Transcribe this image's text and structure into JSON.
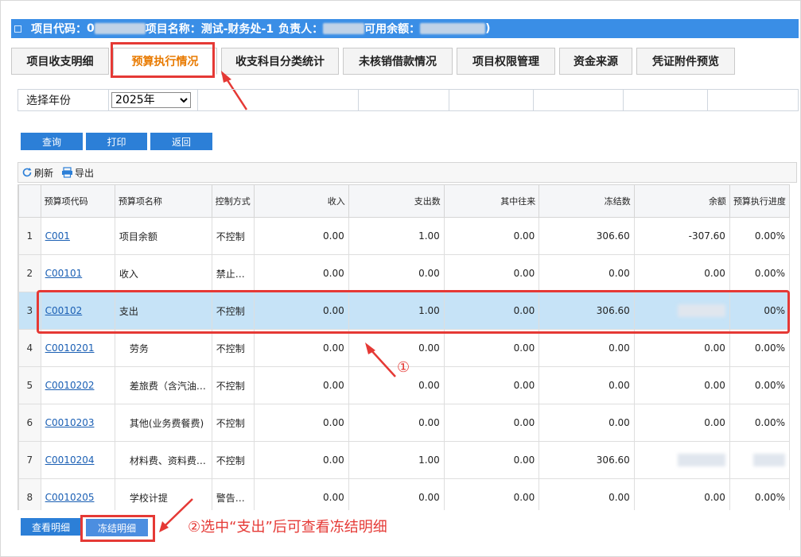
{
  "header": {
    "project_code_label": "项目代码：",
    "project_code_value": "0",
    "project_name_label": "项目名称：",
    "project_name_value": "测试-财务处-1",
    "owner_label": "负责人：",
    "balance_label": "可用余额：",
    "close_paren": ")"
  },
  "tabs": [
    {
      "label": "项目收支明细"
    },
    {
      "label": "预算执行情况"
    },
    {
      "label": "收支科目分类统计"
    },
    {
      "label": "未核销借款情况"
    },
    {
      "label": "项目权限管理"
    },
    {
      "label": "资金来源"
    },
    {
      "label": "凭证附件预览"
    }
  ],
  "filter": {
    "year_label": "选择年份",
    "year_value": "2025年"
  },
  "buttons": {
    "query": "查询",
    "print": "打印",
    "back": "返回",
    "view_detail": "查看明细",
    "frozen_detail": "冻结明细"
  },
  "toolbar": {
    "refresh": "刷新",
    "export": "导出"
  },
  "table": {
    "headers": [
      "预算项代码",
      "预算项名称",
      "控制方式",
      "收入",
      "支出数",
      "其中往来",
      "冻结数",
      "余额",
      "预算执行进度"
    ],
    "rows": [
      {
        "idx": "1",
        "code": "C001",
        "name": "项目余额",
        "control": "不控制",
        "income": "0.00",
        "expense": "1.00",
        "transit": "0.00",
        "frozen": "306.60",
        "balance": "-307.60",
        "progress": "0.00%"
      },
      {
        "idx": "2",
        "code": "C00101",
        "name": "收入",
        "control": "禁止…",
        "income": "0.00",
        "expense": "0.00",
        "transit": "0.00",
        "frozen": "0.00",
        "balance": "0.00",
        "progress": "0.00%"
      },
      {
        "idx": "3",
        "code": "C00102",
        "name": "支出",
        "control": "不控制",
        "income": "0.00",
        "expense": "1.00",
        "transit": "0.00",
        "frozen": "306.60",
        "balance": "",
        "progress": "00%"
      },
      {
        "idx": "4",
        "code": "C0010201",
        "name": "劳务",
        "control": "不控制",
        "income": "0.00",
        "expense": "0.00",
        "transit": "0.00",
        "frozen": "0.00",
        "balance": "0.00",
        "progress": "0.00%"
      },
      {
        "idx": "5",
        "code": "C0010202",
        "name": "差旅费（含汽油…",
        "control": "不控制",
        "income": "0.00",
        "expense": "0.00",
        "transit": "0.00",
        "frozen": "0.00",
        "balance": "0.00",
        "progress": "0.00%"
      },
      {
        "idx": "6",
        "code": "C0010203",
        "name": "其他(业务费餐费)",
        "control": "不控制",
        "income": "0.00",
        "expense": "0.00",
        "transit": "0.00",
        "frozen": "0.00",
        "balance": "0.00",
        "progress": "0.00%"
      },
      {
        "idx": "7",
        "code": "C0010204",
        "name": "材料费、资料费…",
        "control": "不控制",
        "income": "0.00",
        "expense": "1.00",
        "transit": "0.00",
        "frozen": "306.60",
        "balance": "",
        "progress": ""
      },
      {
        "idx": "8",
        "code": "C0010205",
        "name": "学校计提",
        "control": "警告…",
        "income": "0.00",
        "expense": "0.00",
        "transit": "0.00",
        "frozen": "0.00",
        "balance": "0.00",
        "progress": "0.00%"
      }
    ]
  },
  "annotations": {
    "step1": "①",
    "step2": "②选中“支出”后可查看冻结明细"
  },
  "colors": {
    "accent": "#3a8ee6",
    "button": "#2c7fd7",
    "highlight": "#e53935",
    "selected_row": "#c6e3f7",
    "active_tab_text": "#e87a00"
  }
}
